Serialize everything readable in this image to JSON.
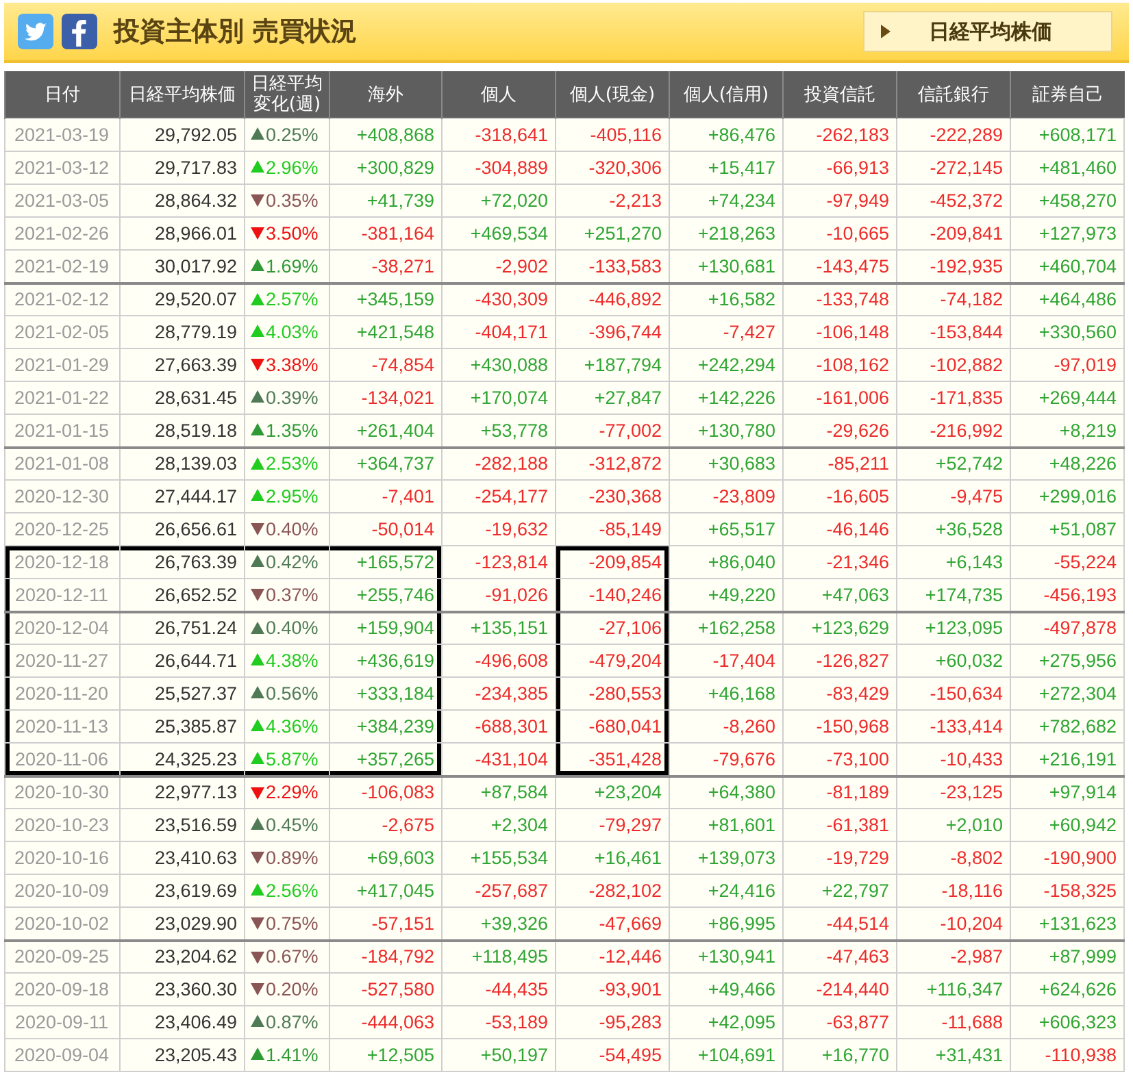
{
  "header": {
    "title": "投資主体別 売買状況",
    "index_button": "日経平均株価"
  },
  "columns": [
    {
      "label": "日付",
      "framed": true
    },
    {
      "label": "日経平均株価",
      "framed": true
    },
    {
      "label": "日経平均変化(週)",
      "framed": true
    },
    {
      "label": "海外",
      "framed": true
    },
    {
      "label": "個人",
      "framed": false
    },
    {
      "label": "個人(現金)",
      "framed": true
    },
    {
      "label": "個人(信用)",
      "framed": false
    },
    {
      "label": "投資信託",
      "framed": false
    },
    {
      "label": "信託銀行",
      "framed": false
    },
    {
      "label": "証券自己",
      "framed": false
    }
  ],
  "rows": [
    {
      "date": "2021-03-19",
      "price": "29,792.05",
      "change": {
        "text": "0.25%",
        "kind": "upweak"
      },
      "values": [
        "+408,868",
        "-318,641",
        "-405,116",
        "+86,476",
        "-262,183",
        "-222,289",
        "+608,171"
      ],
      "gains": [
        true,
        false,
        false,
        true,
        false,
        false,
        true
      ],
      "section_start": false,
      "framed": false
    },
    {
      "date": "2021-03-12",
      "price": "29,717.83",
      "change": {
        "text": "2.96%",
        "kind": "upstrong"
      },
      "values": [
        "+300,829",
        "-304,889",
        "-320,306",
        "+15,417",
        "-66,913",
        "-272,145",
        "+481,460"
      ],
      "gains": [
        true,
        false,
        false,
        true,
        false,
        false,
        true
      ],
      "section_start": false,
      "framed": false
    },
    {
      "date": "2021-03-05",
      "price": "28,864.32",
      "change": {
        "text": "0.35%",
        "kind": "downweak"
      },
      "values": [
        "+41,739",
        "+72,020",
        "-2,213",
        "+74,234",
        "-97,949",
        "-452,372",
        "+458,270"
      ],
      "gains": [
        true,
        true,
        false,
        true,
        false,
        false,
        true
      ],
      "section_start": false,
      "framed": false
    },
    {
      "date": "2021-02-26",
      "price": "28,966.01",
      "change": {
        "text": "3.50%",
        "kind": "downstrong"
      },
      "values": [
        "-381,164",
        "+469,534",
        "+251,270",
        "+218,263",
        "-10,665",
        "-209,841",
        "+127,973"
      ],
      "gains": [
        false,
        true,
        true,
        true,
        false,
        false,
        true
      ],
      "section_start": false,
      "framed": false
    },
    {
      "date": "2021-02-19",
      "price": "30,017.92",
      "change": {
        "text": "1.69%",
        "kind": "upmid"
      },
      "values": [
        "-38,271",
        "-2,902",
        "-133,583",
        "+130,681",
        "-143,475",
        "-192,935",
        "+460,704"
      ],
      "gains": [
        false,
        false,
        false,
        true,
        false,
        false,
        true
      ],
      "section_start": false,
      "framed": false
    },
    {
      "date": "2021-02-12",
      "price": "29,520.07",
      "change": {
        "text": "2.57%",
        "kind": "upstrong"
      },
      "values": [
        "+345,159",
        "-430,309",
        "-446,892",
        "+16,582",
        "-133,748",
        "-74,182",
        "+464,486"
      ],
      "gains": [
        true,
        false,
        false,
        true,
        false,
        false,
        true
      ],
      "section_start": true,
      "framed": false
    },
    {
      "date": "2021-02-05",
      "price": "28,779.19",
      "change": {
        "text": "4.03%",
        "kind": "upstrong"
      },
      "values": [
        "+421,548",
        "-404,171",
        "-396,744",
        "-7,427",
        "-106,148",
        "-153,844",
        "+330,560"
      ],
      "gains": [
        true,
        false,
        false,
        false,
        false,
        false,
        true
      ],
      "section_start": false,
      "framed": false
    },
    {
      "date": "2021-01-29",
      "price": "27,663.39",
      "change": {
        "text": "3.38%",
        "kind": "downstrong"
      },
      "values": [
        "-74,854",
        "+430,088",
        "+187,794",
        "+242,294",
        "-108,162",
        "-102,882",
        "-97,019"
      ],
      "gains": [
        false,
        true,
        true,
        true,
        false,
        false,
        false
      ],
      "section_start": false,
      "framed": false
    },
    {
      "date": "2021-01-22",
      "price": "28,631.45",
      "change": {
        "text": "0.39%",
        "kind": "upweak"
      },
      "values": [
        "-134,021",
        "+170,074",
        "+27,847",
        "+142,226",
        "-161,006",
        "-171,835",
        "+269,444"
      ],
      "gains": [
        false,
        true,
        true,
        true,
        false,
        false,
        true
      ],
      "section_start": false,
      "framed": false
    },
    {
      "date": "2021-01-15",
      "price": "28,519.18",
      "change": {
        "text": "1.35%",
        "kind": "upmid"
      },
      "values": [
        "+261,404",
        "+53,778",
        "-77,002",
        "+130,780",
        "-29,626",
        "-216,992",
        "+8,219"
      ],
      "gains": [
        true,
        true,
        false,
        true,
        false,
        false,
        true
      ],
      "section_start": false,
      "framed": false
    },
    {
      "date": "2021-01-08",
      "price": "28,139.03",
      "change": {
        "text": "2.53%",
        "kind": "upstrong"
      },
      "values": [
        "+364,737",
        "-282,188",
        "-312,872",
        "+30,683",
        "-85,211",
        "+52,742",
        "+48,226"
      ],
      "gains": [
        true,
        false,
        false,
        true,
        false,
        true,
        true
      ],
      "section_start": true,
      "framed": false
    },
    {
      "date": "2020-12-30",
      "price": "27,444.17",
      "change": {
        "text": "2.95%",
        "kind": "upstrong"
      },
      "values": [
        "-7,401",
        "-254,177",
        "-230,368",
        "-23,809",
        "-16,605",
        "-9,475",
        "+299,016"
      ],
      "gains": [
        false,
        false,
        false,
        false,
        false,
        false,
        true
      ],
      "section_start": false,
      "framed": false
    },
    {
      "date": "2020-12-25",
      "price": "26,656.61",
      "change": {
        "text": "0.40%",
        "kind": "downweak"
      },
      "values": [
        "-50,014",
        "-19,632",
        "-85,149",
        "+65,517",
        "-46,146",
        "+36,528",
        "+51,087"
      ],
      "gains": [
        false,
        false,
        false,
        true,
        false,
        true,
        true
      ],
      "section_start": false,
      "framed": false
    },
    {
      "date": "2020-12-18",
      "price": "26,763.39",
      "change": {
        "text": "0.42%",
        "kind": "upweak"
      },
      "values": [
        "+165,572",
        "-123,814",
        "-209,854",
        "+86,040",
        "-21,346",
        "+6,143",
        "-55,224"
      ],
      "gains": [
        true,
        false,
        false,
        true,
        false,
        true,
        false
      ],
      "section_start": false,
      "framed": true
    },
    {
      "date": "2020-12-11",
      "price": "26,652.52",
      "change": {
        "text": "0.37%",
        "kind": "downweak"
      },
      "values": [
        "+255,746",
        "-91,026",
        "-140,246",
        "+49,220",
        "+47,063",
        "+174,735",
        "-456,193"
      ],
      "gains": [
        true,
        false,
        false,
        true,
        true,
        true,
        false
      ],
      "section_start": false,
      "framed": true
    },
    {
      "date": "2020-12-04",
      "price": "26,751.24",
      "change": {
        "text": "0.40%",
        "kind": "upweak"
      },
      "values": [
        "+159,904",
        "+135,151",
        "-27,106",
        "+162,258",
        "+123,629",
        "+123,095",
        "-497,878"
      ],
      "gains": [
        true,
        true,
        false,
        true,
        true,
        true,
        false
      ],
      "section_start": true,
      "framed": true
    },
    {
      "date": "2020-11-27",
      "price": "26,644.71",
      "change": {
        "text": "4.38%",
        "kind": "upstrong"
      },
      "values": [
        "+436,619",
        "-496,608",
        "-479,204",
        "-17,404",
        "-126,827",
        "+60,032",
        "+275,956"
      ],
      "gains": [
        true,
        false,
        false,
        false,
        false,
        true,
        true
      ],
      "section_start": false,
      "framed": true
    },
    {
      "date": "2020-11-20",
      "price": "25,527.37",
      "change": {
        "text": "0.56%",
        "kind": "upweak"
      },
      "values": [
        "+333,184",
        "-234,385",
        "-280,553",
        "+46,168",
        "-83,429",
        "-150,634",
        "+272,304"
      ],
      "gains": [
        true,
        false,
        false,
        true,
        false,
        false,
        true
      ],
      "section_start": false,
      "framed": true
    },
    {
      "date": "2020-11-13",
      "price": "25,385.87",
      "change": {
        "text": "4.36%",
        "kind": "upstrong"
      },
      "values": [
        "+384,239",
        "-688,301",
        "-680,041",
        "-8,260",
        "-150,968",
        "-133,414",
        "+782,682"
      ],
      "gains": [
        true,
        false,
        false,
        false,
        false,
        false,
        true
      ],
      "section_start": false,
      "framed": true
    },
    {
      "date": "2020-11-06",
      "price": "24,325.23",
      "change": {
        "text": "5.87%",
        "kind": "upstrong"
      },
      "values": [
        "+357,265",
        "-431,104",
        "-351,428",
        "-79,676",
        "-73,100",
        "-10,433",
        "+216,191"
      ],
      "gains": [
        true,
        false,
        false,
        false,
        false,
        false,
        true
      ],
      "section_start": false,
      "framed": true
    },
    {
      "date": "2020-10-30",
      "price": "22,977.13",
      "change": {
        "text": "2.29%",
        "kind": "downstrong"
      },
      "values": [
        "-106,083",
        "+87,584",
        "+23,204",
        "+64,380",
        "-81,189",
        "-23,125",
        "+97,914"
      ],
      "gains": [
        false,
        true,
        true,
        true,
        false,
        false,
        true
      ],
      "section_start": true,
      "framed": false
    },
    {
      "date": "2020-10-23",
      "price": "23,516.59",
      "change": {
        "text": "0.45%",
        "kind": "upweak"
      },
      "values": [
        "-2,675",
        "+2,304",
        "-79,297",
        "+81,601",
        "-61,381",
        "+2,010",
        "+60,942"
      ],
      "gains": [
        false,
        true,
        false,
        true,
        false,
        true,
        true
      ],
      "section_start": false,
      "framed": false
    },
    {
      "date": "2020-10-16",
      "price": "23,410.63",
      "change": {
        "text": "0.89%",
        "kind": "downweak"
      },
      "values": [
        "+69,603",
        "+155,534",
        "+16,461",
        "+139,073",
        "-19,729",
        "-8,802",
        "-190,900"
      ],
      "gains": [
        true,
        true,
        true,
        true,
        false,
        false,
        false
      ],
      "section_start": false,
      "framed": false
    },
    {
      "date": "2020-10-09",
      "price": "23,619.69",
      "change": {
        "text": "2.56%",
        "kind": "upstrong"
      },
      "values": [
        "+417,045",
        "-257,687",
        "-282,102",
        "+24,416",
        "+22,797",
        "-18,116",
        "-158,325"
      ],
      "gains": [
        true,
        false,
        false,
        true,
        true,
        false,
        false
      ],
      "section_start": false,
      "framed": false
    },
    {
      "date": "2020-10-02",
      "price": "23,029.90",
      "change": {
        "text": "0.75%",
        "kind": "downweak"
      },
      "values": [
        "-57,151",
        "+39,326",
        "-47,669",
        "+86,995",
        "-44,514",
        "-10,204",
        "+131,623"
      ],
      "gains": [
        false,
        true,
        false,
        true,
        false,
        false,
        true
      ],
      "section_start": false,
      "framed": false
    },
    {
      "date": "2020-09-25",
      "price": "23,204.62",
      "change": {
        "text": "0.67%",
        "kind": "downweak"
      },
      "values": [
        "-184,792",
        "+118,495",
        "-12,446",
        "+130,941",
        "-47,463",
        "-2,987",
        "+87,999"
      ],
      "gains": [
        false,
        true,
        false,
        true,
        false,
        false,
        true
      ],
      "section_start": true,
      "framed": false
    },
    {
      "date": "2020-09-18",
      "price": "23,360.30",
      "change": {
        "text": "0.20%",
        "kind": "downweak"
      },
      "values": [
        "-527,580",
        "-44,435",
        "-93,901",
        "+49,466",
        "-214,440",
        "+116,347",
        "+624,626"
      ],
      "gains": [
        false,
        false,
        false,
        true,
        false,
        true,
        true
      ],
      "section_start": false,
      "framed": false
    },
    {
      "date": "2020-09-11",
      "price": "23,406.49",
      "change": {
        "text": "0.87%",
        "kind": "upweak"
      },
      "values": [
        "-444,063",
        "-53,189",
        "-95,283",
        "+42,095",
        "-63,877",
        "-11,688",
        "+606,323"
      ],
      "gains": [
        false,
        false,
        false,
        true,
        false,
        false,
        true
      ],
      "section_start": false,
      "framed": false
    },
    {
      "date": "2020-09-04",
      "price": "23,205.43",
      "change": {
        "text": "1.41%",
        "kind": "upmid"
      },
      "values": [
        "+12,505",
        "+50,197",
        "-54,495",
        "+104,691",
        "+16,770",
        "+31,431",
        "-110,938"
      ],
      "gains": [
        true,
        true,
        false,
        true,
        true,
        true,
        false
      ],
      "section_start": false,
      "framed": false
    }
  ]
}
